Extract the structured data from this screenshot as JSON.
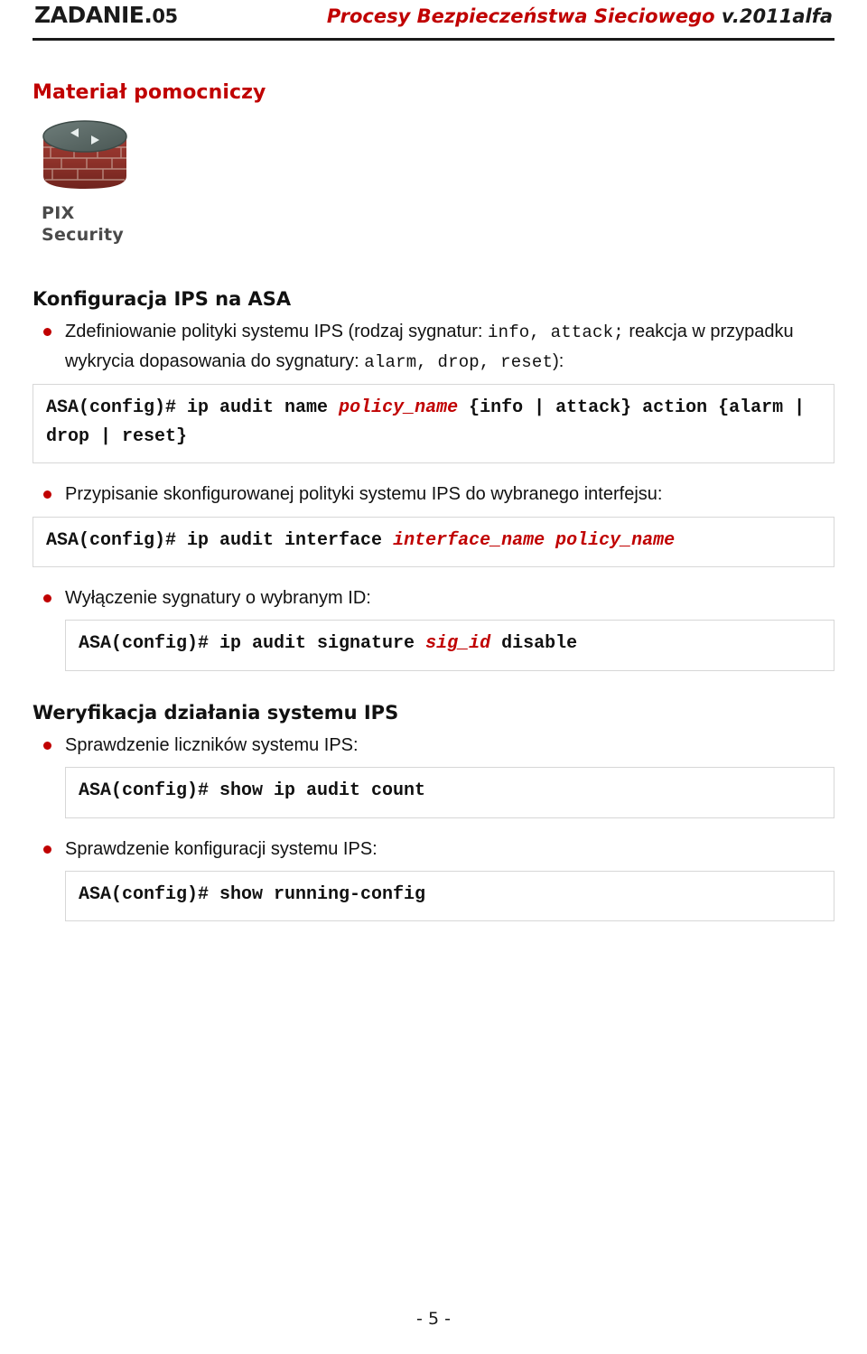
{
  "header": {
    "task_label": "ZADANIE.",
    "task_number": "05",
    "course_title": "Procesy Bezpieczeństwa Sieciowego",
    "version": "v.2011alfa"
  },
  "doc": {
    "section_title": "Materiał pomocniczy",
    "graphic_label_line1": "PIX",
    "graphic_label_line2": "Security",
    "heading_ips_asa": "Konfiguracja IPS na ASA",
    "heading_verification": "Weryfikacja działania systemu IPS",
    "bullet1": "Zdefiniowanie polityki systemu IPS (rodzaj sygnatur: ",
    "bullet1_mono1": "info, attack;",
    "bullet1_cont": " reakcja w przypadku wykrycia dopasowania do sygnatury: ",
    "bullet1_mono2": "alarm, drop, reset",
    "bullet1_end": "):",
    "code1_a": "ASA(config)# ip audit name ",
    "code1_var": "policy_name",
    "code1_b": " {info | attack} action {alarm | drop | reset}",
    "bullet2": "Przypisanie skonfigurowanej polityki systemu IPS do wybranego interfejsu:",
    "code2_a": "ASA(config)# ip audit interface ",
    "code2_var1": "interface_name",
    "code2_var2": "policy_name",
    "bullet3": "Wyłączenie sygnatury o wybranym ID:",
    "code3_a": "ASA(config)# ip audit signature ",
    "code3_var": "sig_id",
    "code3_b": " disable",
    "bullet4": "Sprawdzenie liczników systemu IPS:",
    "code4": "ASA(config)# show ip audit count",
    "bullet5": "Sprawdzenie konfiguracji systemu IPS:",
    "code5": "ASA(config)# show running-config"
  },
  "footer": {
    "page_number": "- 5 -"
  }
}
